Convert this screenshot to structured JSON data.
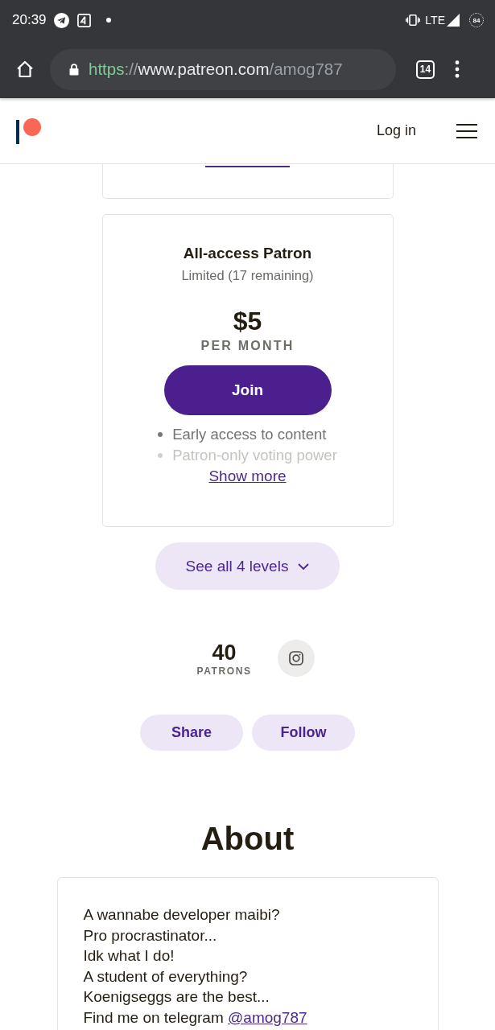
{
  "status_bar": {
    "time": "20:39",
    "network": "LTE",
    "battery": "84"
  },
  "browser": {
    "url": {
      "scheme": "https",
      "separator": "://",
      "host": "www.patreon.com",
      "path": "/amog787"
    },
    "tab_count": "14"
  },
  "header": {
    "login": "Log in"
  },
  "tier": {
    "title": "All-access Patron",
    "availability": "Limited (17 remaining)",
    "price": "$5",
    "period": "PER MONTH",
    "join": "Join",
    "benefits": [
      {
        "text": "Early access to content",
        "faded": false
      },
      {
        "text": "Patron-only voting power",
        "faded": true
      }
    ],
    "show_more": "Show more"
  },
  "levels_button": "See all 4 levels",
  "stats": {
    "count": "40",
    "label": "PATRONS"
  },
  "actions": [
    "Share",
    "Follow"
  ],
  "about": {
    "heading": "About",
    "lines": [
      {
        "text": "A wannabe developer maibi?"
      },
      {
        "text": "Pro procrastinator..."
      },
      {
        "text": "Idk what I do!"
      },
      {
        "text": "A student of everything?"
      },
      {
        "text": "Koenigseggs are the best..."
      },
      {
        "text": "Find me on telegram",
        "link": "@amog787"
      }
    ]
  }
}
